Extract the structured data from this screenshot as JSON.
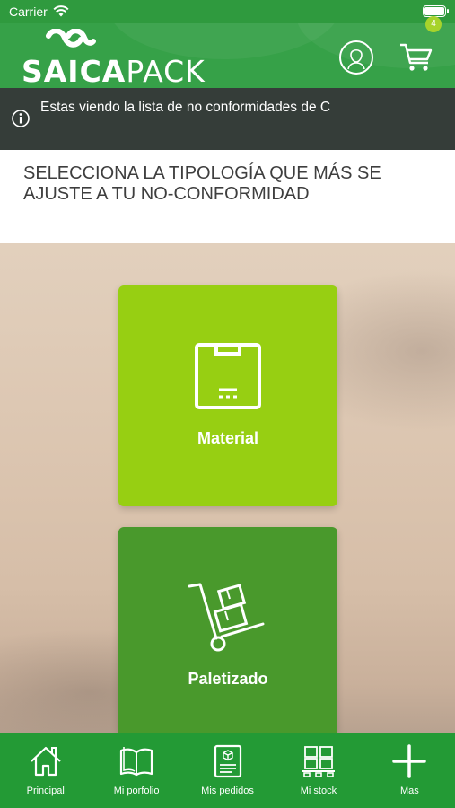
{
  "status_bar": {
    "carrier": "Carrier"
  },
  "header": {
    "logo_text_bold": "SAICA",
    "logo_text_light": "PACK",
    "cart_count": "4"
  },
  "info": {
    "message": "Estas viendo la lista de no conformidades de C"
  },
  "prompt": {
    "title": "SELECCIONA LA TIPOLOGÍA QUE MÁS SE AJUSTE A TU NO-CONFORMIDAD"
  },
  "cards": {
    "material": {
      "label": "Material",
      "icon": "box-icon",
      "color": "#97cf12"
    },
    "paletizado": {
      "label": "Paletizado",
      "icon": "hand-truck-icon",
      "color": "#49992c"
    }
  },
  "tabs": [
    {
      "label": "Principal",
      "icon": "home-icon"
    },
    {
      "label": "Mi porfolio",
      "icon": "book-icon"
    },
    {
      "label": "Mis pedidos",
      "icon": "order-document-icon"
    },
    {
      "label": "Mi stock",
      "icon": "stock-pallet-icon"
    },
    {
      "label": "Mas",
      "icon": "plus-icon"
    }
  ],
  "colors": {
    "brand_green": "#36a148",
    "tabbar_green": "#239a35",
    "info_bar": "#353d39"
  }
}
